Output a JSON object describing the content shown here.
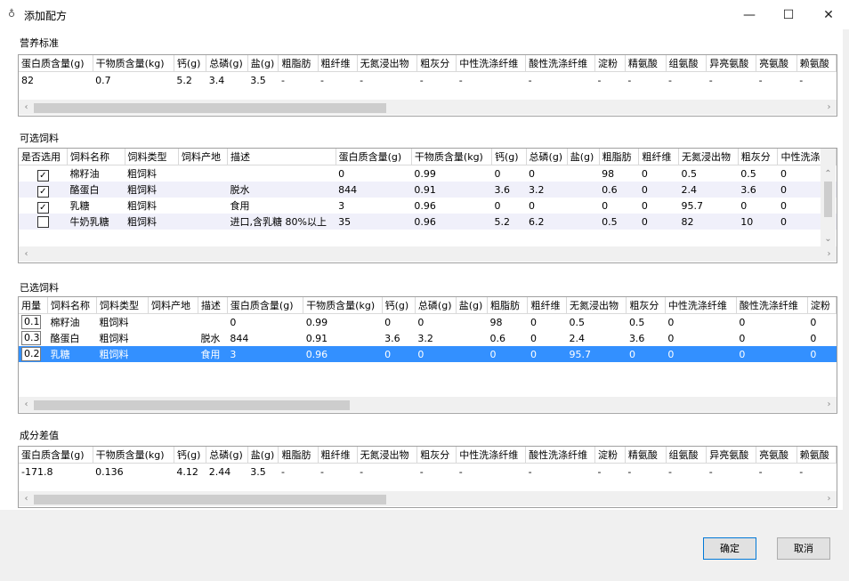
{
  "window": {
    "title": "添加配方",
    "icon": "app-icon",
    "controls": {
      "minimize": "—",
      "maximize": "☐",
      "close": "✕"
    }
  },
  "nutrition_standard": {
    "section_title": "营养标准",
    "columns": [
      "蛋白质含量(g)",
      "干物质含量(kg)",
      "钙(g)",
      "总磷(g)",
      "盐(g)",
      "粗脂肪",
      "粗纤维",
      "无氮浸出物",
      "粗灰分",
      "中性洗涤纤维",
      "酸性洗涤纤维",
      "淀粉",
      "精氨酸",
      "组氨酸",
      "异亮氨酸",
      "亮氨酸",
      "赖氨酸"
    ],
    "rows": [
      [
        "82",
        "0.7",
        "5.2",
        "3.4",
        "3.5",
        "-",
        "-",
        "-",
        "-",
        "-",
        "-",
        "-",
        "-",
        "-",
        "-",
        "-",
        "-"
      ]
    ]
  },
  "available_feeds": {
    "section_title": "可选饲料",
    "columns": [
      "是否选用",
      "饲料名称",
      "饲料类型",
      "饲料产地",
      "描述",
      "蛋白质含量(g)",
      "干物质含量(kg)",
      "钙(g)",
      "总磷(g)",
      "盐(g)",
      "粗脂肪",
      "粗纤维",
      "无氮浸出物",
      "粗灰分",
      "中性洗涤纤"
    ],
    "rows": [
      {
        "checked": "✓",
        "cells": [
          "棉籽油",
          "粗饲料",
          "",
          "",
          "0",
          "0.99",
          "0",
          "0",
          "",
          "98",
          "0",
          "0.5",
          "0.5",
          "0"
        ]
      },
      {
        "checked": "✓",
        "cells": [
          "酪蛋白",
          "粗饲料",
          "",
          "脱水",
          "844",
          "0.91",
          "3.6",
          "3.2",
          "",
          "0.6",
          "0",
          "2.4",
          "3.6",
          "0"
        ]
      },
      {
        "checked": "✓",
        "cells": [
          "乳糖",
          "粗饲料",
          "",
          "食用",
          "3",
          "0.96",
          "0",
          "0",
          "",
          "0",
          "0",
          "95.7",
          "0",
          "0"
        ]
      },
      {
        "checked": "",
        "cells": [
          "牛奶乳糖",
          "粗饲料",
          "",
          "进口,含乳糖 80%以上",
          "35",
          "0.96",
          "5.2",
          "6.2",
          "",
          "0.5",
          "0",
          "82",
          "10",
          "0"
        ]
      }
    ]
  },
  "selected_feeds": {
    "section_title": "已选饲料",
    "columns": [
      "用量",
      "饲料名称",
      "饲料类型",
      "饲料产地",
      "描述",
      "蛋白质含量(g)",
      "干物质含量(kg)",
      "钙(g)",
      "总磷(g)",
      "盐(g)",
      "粗脂肪",
      "粗纤维",
      "无氮浸出物",
      "粗灰分",
      "中性洗涤纤维",
      "酸性洗涤纤维",
      "淀粉"
    ],
    "rows": [
      {
        "qty": "0.1",
        "cells": [
          "棉籽油",
          "粗饲料",
          "",
          "",
          "0",
          "0.99",
          "0",
          "0",
          "",
          "98",
          "0",
          "0.5",
          "0.5",
          "0",
          "0",
          "0"
        ]
      },
      {
        "qty": "0.3",
        "cells": [
          "酪蛋白",
          "粗饲料",
          "",
          "脱水",
          "844",
          "0.91",
          "3.6",
          "3.2",
          "",
          "0.6",
          "0",
          "2.4",
          "3.6",
          "0",
          "0",
          "0"
        ]
      },
      {
        "qty": "0.2",
        "cells": [
          "乳糖",
          "粗饲料",
          "",
          "食用",
          "3",
          "0.96",
          "0",
          "0",
          "",
          "0",
          "0",
          "95.7",
          "0",
          "0",
          "0",
          "0"
        ]
      }
    ]
  },
  "difference": {
    "section_title": "成分差值",
    "columns": [
      "蛋白质含量(g)",
      "干物质含量(kg)",
      "钙(g)",
      "总磷(g)",
      "盐(g)",
      "粗脂肪",
      "粗纤维",
      "无氮浸出物",
      "粗灰分",
      "中性洗涤纤维",
      "酸性洗涤纤维",
      "淀粉",
      "精氨酸",
      "组氨酸",
      "异亮氨酸",
      "亮氨酸",
      "赖氨酸"
    ],
    "rows": [
      [
        "-171.8",
        "0.136",
        "4.12",
        "2.44",
        "3.5",
        "-",
        "-",
        "-",
        "-",
        "-",
        "-",
        "-",
        "-",
        "-",
        "-",
        "-",
        "-"
      ]
    ]
  },
  "buttons": {
    "confirm": "确定",
    "cancel": "取消"
  },
  "colors": {
    "selection": "#3390ff",
    "alt_row": "#f0f0fa",
    "accent_border": "#0078d7"
  }
}
